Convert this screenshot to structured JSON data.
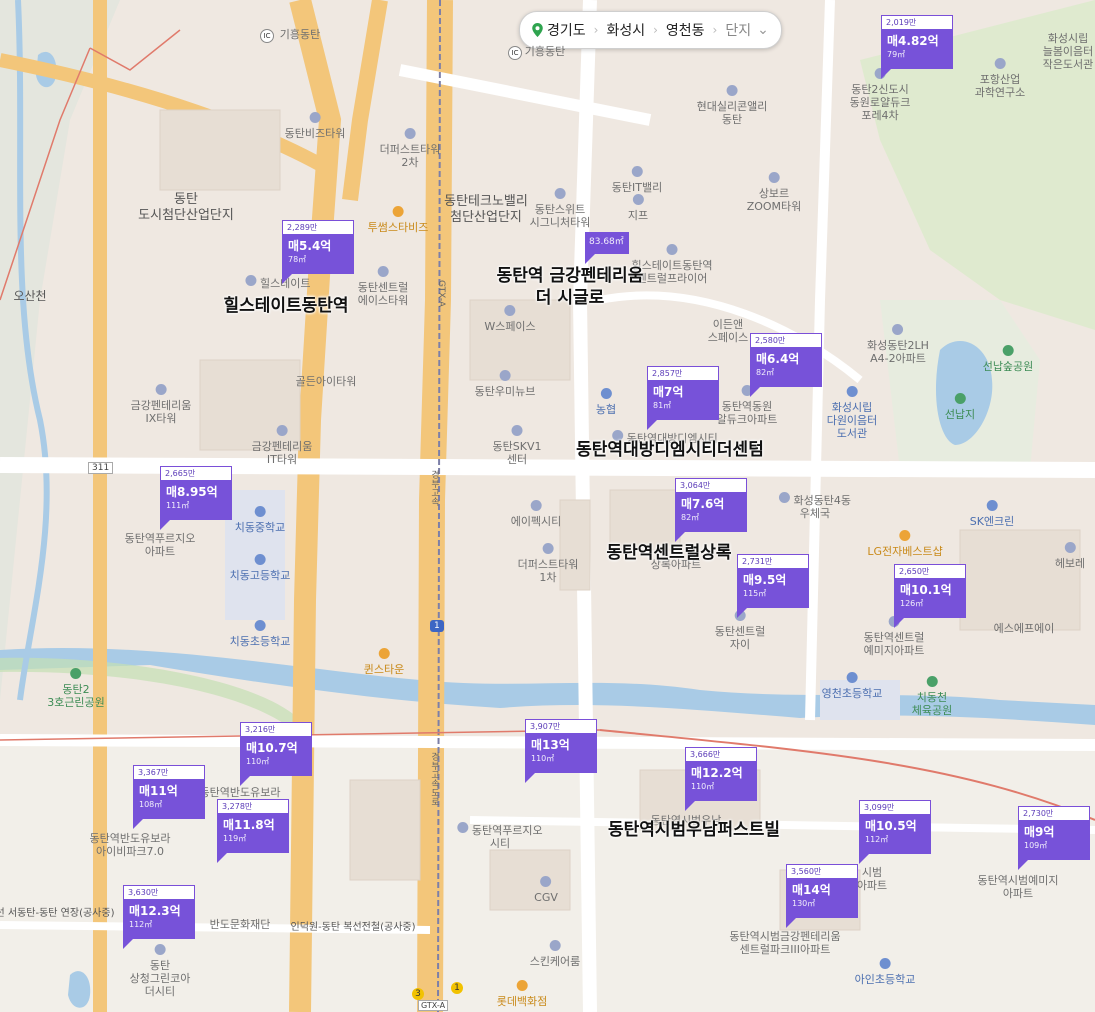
{
  "breadcrumb": {
    "province": "경기도",
    "city": "화성시",
    "district": "영천동",
    "level": "단지",
    "icons": {
      "location": "map-pin-icon",
      "expand": "chevron-down-icon"
    }
  },
  "colors": {
    "marker": "#7752d9",
    "water": "#a9cbe6",
    "green": "#c5dfb4",
    "road_major": "#f2c87a",
    "road_minor": "#ffffff",
    "rail": "#e07a6b"
  },
  "markers": [
    {
      "id": "hills",
      "unit_price": "2,289만",
      "price": "매5.4억",
      "area": "78㎡"
    },
    {
      "id": "4p82",
      "unit_price": "2,019만",
      "price": "매4.82억",
      "area": "79㎡"
    },
    {
      "id": "geum",
      "area_only": "83.68㎡"
    },
    {
      "id": "6p4",
      "unit_price": "2,580만",
      "price": "매6.4억",
      "area": "82㎡"
    },
    {
      "id": "7",
      "unit_price": "2,857만",
      "price": "매7억",
      "area": "81㎡"
    },
    {
      "id": "8p95",
      "unit_price": "2,665만",
      "price": "매8.95억",
      "area": "111㎡"
    },
    {
      "id": "7p6",
      "unit_price": "3,064만",
      "price": "매7.6억",
      "area": "82㎡"
    },
    {
      "id": "9p5",
      "unit_price": "2,731만",
      "price": "매9.5억",
      "area": "115㎡"
    },
    {
      "id": "10p1",
      "unit_price": "2,650만",
      "price": "매10.1억",
      "area": "126㎡"
    },
    {
      "id": "10p7",
      "unit_price": "3,216만",
      "price": "매10.7억",
      "area": "110㎡"
    },
    {
      "id": "13",
      "unit_price": "3,907만",
      "price": "매13억",
      "area": "110㎡"
    },
    {
      "id": "11",
      "unit_price": "3,367만",
      "price": "매11억",
      "area": "108㎡"
    },
    {
      "id": "11p8",
      "unit_price": "3,278만",
      "price": "매11.8억",
      "area": "119㎡"
    },
    {
      "id": "12p2",
      "unit_price": "3,666만",
      "price": "매12.2억",
      "area": "110㎡"
    },
    {
      "id": "10p5",
      "unit_price": "3,099만",
      "price": "매10.5억",
      "area": "112㎡"
    },
    {
      "id": "9",
      "unit_price": "2,730만",
      "price": "매9억",
      "area": "109㎡"
    },
    {
      "id": "14",
      "unit_price": "3,560만",
      "price": "매14억",
      "area": "130㎡"
    },
    {
      "id": "12p3",
      "unit_price": "3,630만",
      "price": "매12.3억",
      "area": "112㎡"
    }
  ],
  "complex_labels": {
    "hills": "힐스테이트동탄역",
    "geum_1": "동탄역 금강펜테리움",
    "geum_2": "더 시글로",
    "daebang": "동탄역대방디엠시티더센텀",
    "central": "동탄역센트럴상록",
    "sibeom": "동탄역시범우남퍼스트빌"
  },
  "areas": {
    "dongtan_ind_1": "동탄",
    "dongtan_ind_2": "도시첨단산업단지",
    "techno_1": "동탄테크노밸리",
    "techno_2": "첨단산업단지",
    "osancheon": "오산천"
  },
  "pois": {
    "giheung_ic_top": "기흥동탄",
    "giheung_ic": "기흥동탄",
    "dongtan_biz": "동탄비즈타워",
    "the_first_1": "더퍼스트타워",
    "the_first_1b": "2차",
    "hyundai_1": "현대실리콘앨리",
    "hyundai_2": "동탄",
    "dongtan2_1": "동탄2신도시",
    "dongtan2_2": "동원로얄듀크",
    "dongtan2_3": "포레4차",
    "posan_1": "포항산업",
    "posan_2": "과학연구소",
    "hs_lib_1": "화성시립",
    "hs_lib_2": "늘봄이음터",
    "hs_lib_3": "작은도서관",
    "twosome": "투썸스타비즈",
    "suite_1": "동탄스위트",
    "suite_2": "시그니처타워",
    "it_valley": "동탄IT밸리",
    "jipeu": "지프",
    "zoom_1": "상보르",
    "zoom_2": "ZOOM타워",
    "hills_biz_1": "힐스테이트동탄역",
    "hills_biz_2": "센트럴프라이어",
    "hills_small": "힐스테이트",
    "central_ace_1": "동탄센트럴",
    "central_ace_2": "에이스타워",
    "wspace": "W스페이스",
    "eden_1": "이든앤",
    "eden_2": "스페이스",
    "lh2_1": "화성동탄2LH",
    "lh2_2": "A4-2아파트",
    "seonnap_park": "선납숲공원",
    "seonnap_lake": "선납지",
    "golden_eye": "골든아이타워",
    "umi_new": "동탄우미뉴브",
    "nonghyup": "농협",
    "dongwon_1": "동탄역동원",
    "dongwon_2": "알듀크아파트",
    "hs_lib2_1": "화성시립",
    "hs_lib2_2": "다원이음터",
    "hs_lib2_3": "도서관",
    "geum_ix_1": "금강펜테리움",
    "geum_ix_2": "IX타워",
    "geum_it_1": "금강펜테리움",
    "geum_it_2": "IT타워",
    "skv1_1": "동탄SKV1",
    "skv1_2": "센터",
    "daebang_small": "동탄역대방디엠시티",
    "prugio_1": "동탄역푸르지오",
    "prugio_2": "아파트",
    "chidong_mid": "치동중학교",
    "chidong_high": "치동고등학교",
    "chidong_elem": "치동초등학교",
    "apec": "에이펙시티",
    "the_first2_1": "더퍼스트타워",
    "the_first2_2": "1차",
    "sangrok_small": "상록아파트",
    "hs_post_1": "화성동탄4동",
    "hs_post_2": "우체국",
    "lg_best": "LG전자베스트샵",
    "sk_enclean": "SK엔크린",
    "hebore": "헤보레",
    "central_xi_1": "동탄센트럴",
    "central_xi_2": "자이",
    "emiji_1": "동탄역센트럴",
    "emiji_2": "예미지아파트",
    "sf": "에스에프에이",
    "queens": "퀸스타운",
    "cheon_park_1": "치동천",
    "cheon_park_2": "체육공원",
    "yeongcheon_elem": "영천초등학교",
    "park3_1": "동탄2",
    "park3_2": "3호근린공원",
    "banbora_small": "동탄역반도유보라",
    "banbora_1": "동탄역반도유보라",
    "banbora_2": "아이비파크7.0",
    "prugio2_1": "동탄역푸르지오",
    "prugio2_2": "시티",
    "cgv": "CGV",
    "sibeom_small": "동탄역시범우남",
    "sibeom_hanbit_1": "시범",
    "sibeom_hanbit_2": "아파트",
    "sibeom_emiji_1": "동탄역시범예미지",
    "sibeom_emiji_2": "아파트",
    "banbora3_1": "동탄역시범금강펜테리움",
    "banbora3_2": "센트럴파크III아파트",
    "bando_culture": "반도문화재단",
    "railline": "인덕원-동탄 복선전철(공사중)",
    "railline2": "선 서동탄-동탄 연장(공사중)",
    "sangsam_1": "동탄",
    "sangsam_2": "상청그린코아",
    "sangsam_3": "더시티",
    "skating": "스킨케어룸",
    "lotte": "롯데백화점",
    "ain_elem": "아인초등학교",
    "gtx_a": "GTX-A",
    "gyeongbu": "경부고속",
    "gyeongbu2": "경부고속도로",
    "r311": "311",
    "exit1": "1",
    "exit3": "3",
    "ic_label": "IC"
  }
}
